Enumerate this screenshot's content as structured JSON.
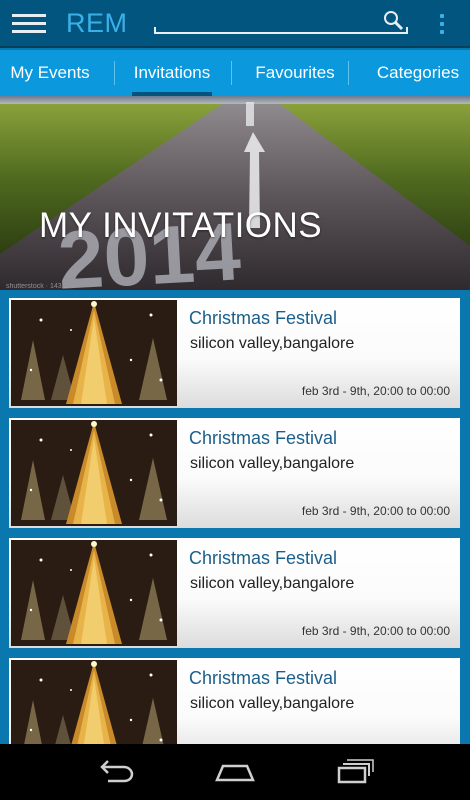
{
  "app": {
    "title": "REM"
  },
  "search": {
    "placeholder": "",
    "value": ""
  },
  "tabs": [
    {
      "label": "My Events"
    },
    {
      "label": "Invitations"
    },
    {
      "label": "Favourites"
    },
    {
      "label": "Categories"
    }
  ],
  "active_tab": "Invitations",
  "banner": {
    "title": "MY INVITATIONS",
    "year_graphic": "2014",
    "watermark": "shutterstock · 143..."
  },
  "events": [
    {
      "title": "Christmas Festival",
      "location": "silicon valley,bangalore",
      "time": "feb 3rd - 9th,  20:00 to 00:00"
    },
    {
      "title": "Christmas Festival",
      "location": "silicon valley,bangalore",
      "time": "feb 3rd - 9th,  20:00 to 00:00"
    },
    {
      "title": "Christmas Festival",
      "location": "silicon valley,bangalore",
      "time": "feb 3rd - 9th,  20:00 to 00:00"
    },
    {
      "title": "Christmas Festival",
      "location": "silicon valley,bangalore",
      "time": ""
    }
  ],
  "icons": {
    "menu": "hamburger-icon",
    "search": "search-icon",
    "overflow": "overflow-menu-icon",
    "back": "back-icon",
    "home": "home-icon",
    "recents": "recent-apps-icon"
  },
  "colors": {
    "app_bar": "#02557f",
    "tab_bar": "#0b98dc",
    "accent": "#3ab0e8",
    "list_background": "#0a78ae",
    "card_title": "#1a5f8c"
  }
}
